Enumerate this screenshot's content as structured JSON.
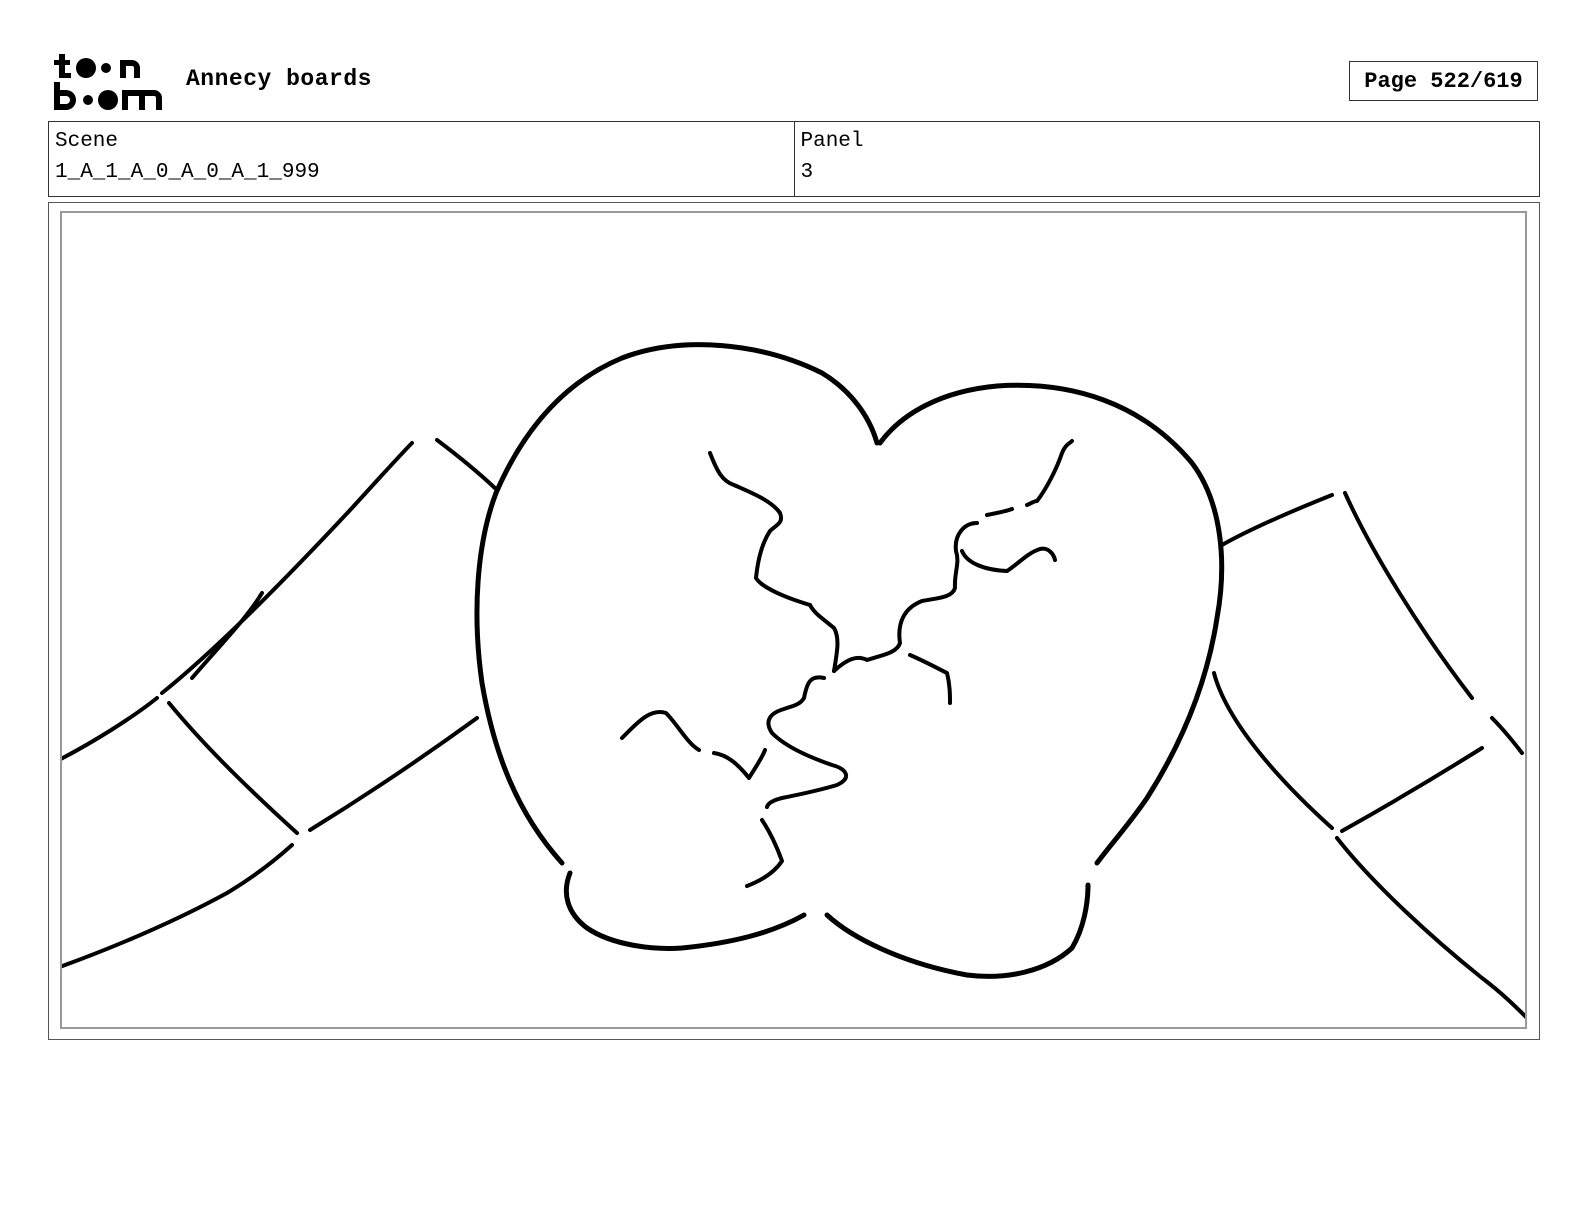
{
  "header": {
    "project_title": "Annecy boards",
    "page_label": "Page 522/619"
  },
  "logo": {
    "line1": "toon",
    "line2": "boom"
  },
  "info": {
    "scene_label": "Scene",
    "scene_value": "1_A_1_A_0_A_0_A_1_999",
    "panel_label": "Panel",
    "panel_value": "3"
  },
  "drawing": {
    "icon": "cracked-heart-sketch-icon",
    "stroke_color": "#000000",
    "frame_color": "#999999"
  }
}
